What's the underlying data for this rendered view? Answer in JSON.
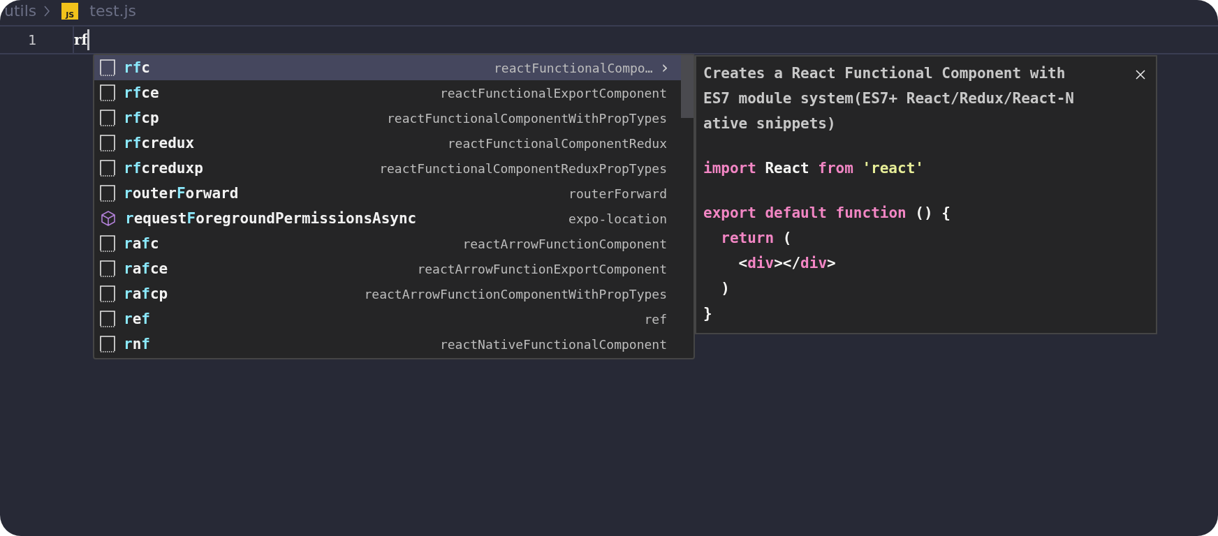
{
  "breadcrumb": {
    "folder": "utils",
    "file_badge": "JS",
    "file": "test.js"
  },
  "editor": {
    "line_number": "1",
    "text": "rf"
  },
  "suggestions": [
    {
      "kind": "snippet",
      "selected": true,
      "parts": [
        {
          "text": "rf",
          "match": true
        },
        {
          "text": "c",
          "match": false
        }
      ],
      "detail": "reactFunctionalCompo…",
      "chevron": "›"
    },
    {
      "kind": "snippet",
      "selected": false,
      "parts": [
        {
          "text": "rf",
          "match": true
        },
        {
          "text": "ce",
          "match": false
        }
      ],
      "detail": "reactFunctionalExportComponent"
    },
    {
      "kind": "snippet",
      "selected": false,
      "parts": [
        {
          "text": "rf",
          "match": true
        },
        {
          "text": "cp",
          "match": false
        }
      ],
      "detail": "reactFunctionalComponentWithPropTypes"
    },
    {
      "kind": "snippet",
      "selected": false,
      "parts": [
        {
          "text": "rf",
          "match": true
        },
        {
          "text": "credux",
          "match": false
        }
      ],
      "detail": "reactFunctionalComponentRedux"
    },
    {
      "kind": "snippet",
      "selected": false,
      "parts": [
        {
          "text": "rf",
          "match": true
        },
        {
          "text": "creduxp",
          "match": false
        }
      ],
      "detail": "reactFunctionalComponentReduxPropTypes"
    },
    {
      "kind": "snippet",
      "selected": false,
      "parts": [
        {
          "text": "r",
          "match": true
        },
        {
          "text": "outer",
          "match": false
        },
        {
          "text": "F",
          "match": true
        },
        {
          "text": "orward",
          "match": false
        }
      ],
      "detail": "routerForward"
    },
    {
      "kind": "module",
      "selected": false,
      "parts": [
        {
          "text": "r",
          "match": true
        },
        {
          "text": "equest",
          "match": false
        },
        {
          "text": "F",
          "match": true
        },
        {
          "text": "oregroundPermissionsAsync",
          "match": false
        }
      ],
      "detail": "expo-location"
    },
    {
      "kind": "snippet",
      "selected": false,
      "parts": [
        {
          "text": "r",
          "match": true
        },
        {
          "text": "a",
          "match": false
        },
        {
          "text": "f",
          "match": true
        },
        {
          "text": "c",
          "match": false
        }
      ],
      "detail": "reactArrowFunctionComponent"
    },
    {
      "kind": "snippet",
      "selected": false,
      "parts": [
        {
          "text": "r",
          "match": true
        },
        {
          "text": "a",
          "match": false
        },
        {
          "text": "f",
          "match": true
        },
        {
          "text": "ce",
          "match": false
        }
      ],
      "detail": "reactArrowFunctionExportComponent"
    },
    {
      "kind": "snippet",
      "selected": false,
      "parts": [
        {
          "text": "r",
          "match": true
        },
        {
          "text": "a",
          "match": false
        },
        {
          "text": "f",
          "match": true
        },
        {
          "text": "cp",
          "match": false
        }
      ],
      "detail": "reactArrowFunctionComponentWithPropTypes"
    },
    {
      "kind": "snippet",
      "selected": false,
      "parts": [
        {
          "text": "r",
          "match": true
        },
        {
          "text": "e",
          "match": false
        },
        {
          "text": "f",
          "match": true
        }
      ],
      "detail": "ref"
    },
    {
      "kind": "snippet",
      "selected": false,
      "parts": [
        {
          "text": "r",
          "match": true
        },
        {
          "text": "n",
          "match": false
        },
        {
          "text": "f",
          "match": true
        }
      ],
      "detail": "reactNativeFunctionalComponent"
    }
  ],
  "details_panel": {
    "description_lines": [
      "Creates a React Functional Component with",
      "ES7 module system(ES7+ React/Redux/React-N",
      "ative snippets)"
    ],
    "code_blocks": [
      [
        [
          {
            "kind": "keyword",
            "text": "import"
          },
          {
            "kind": "plain",
            "text": "React"
          },
          {
            "kind": "keyword",
            "text": "from"
          },
          {
            "kind": "string",
            "text": "'react'"
          }
        ]
      ],
      [
        [
          {
            "kind": "keyword",
            "text": "export"
          },
          {
            "kind": "keyword",
            "text": "default"
          },
          {
            "kind": "keyword",
            "text": "function"
          },
          {
            "kind": "plain",
            "text": "() {"
          }
        ],
        [
          {
            "kind": "keyword",
            "text": "  return"
          },
          {
            "kind": "plain",
            "text": "("
          }
        ],
        [
          {
            "kind": "plain",
            "text": "    <"
          },
          {
            "kind": "keyword",
            "text": "div"
          },
          {
            "kind": "plain",
            "text": "></"
          },
          {
            "kind": "keyword",
            "text": "div"
          },
          {
            "kind": "plain",
            "text": ">"
          }
        ],
        [
          {
            "kind": "plain",
            "text": "  )"
          }
        ],
        [
          {
            "kind": "plain",
            "text": "}"
          }
        ]
      ]
    ]
  }
}
